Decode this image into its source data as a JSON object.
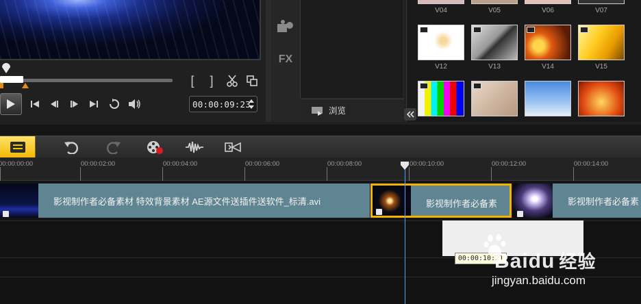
{
  "player": {
    "timecode": "00:00:09:23",
    "mark_in": "[",
    "mark_out": "]"
  },
  "library": {
    "side_labels": {
      "fx": "FX"
    },
    "browse_label": "浏览",
    "thumbnails_row1": [
      "V04",
      "V05",
      "V06",
      "V07"
    ],
    "thumbnails_row2": [
      "V12",
      "V13",
      "V14",
      "V15"
    ]
  },
  "ruler": {
    "labels": [
      "00:00:00:00",
      "00:00:02:00",
      "00:00:04:00",
      "00:00:06:00",
      "00:00:08:00",
      "00:00:10:00",
      "00:00:12:00",
      "00:00:14:00"
    ]
  },
  "timeline": {
    "clip1_title": "影视制作者必备素材 特效背景素材 AE源文件送插件送软件_标清.avi",
    "clip2_title": "影视制作者必备素",
    "clip3_title": "影视制作者必备素",
    "tooltip": "00:00:10:21"
  },
  "watermark": {
    "brand": "Baidu",
    "brand_cn": "经验",
    "url": "jingyan.baidu.com"
  },
  "colors": {
    "accent_yellow": "#f2b800",
    "clip_bg": "#5f8593",
    "clip_selected_border": "#f2b400",
    "playhead": "#4aa3ff"
  }
}
